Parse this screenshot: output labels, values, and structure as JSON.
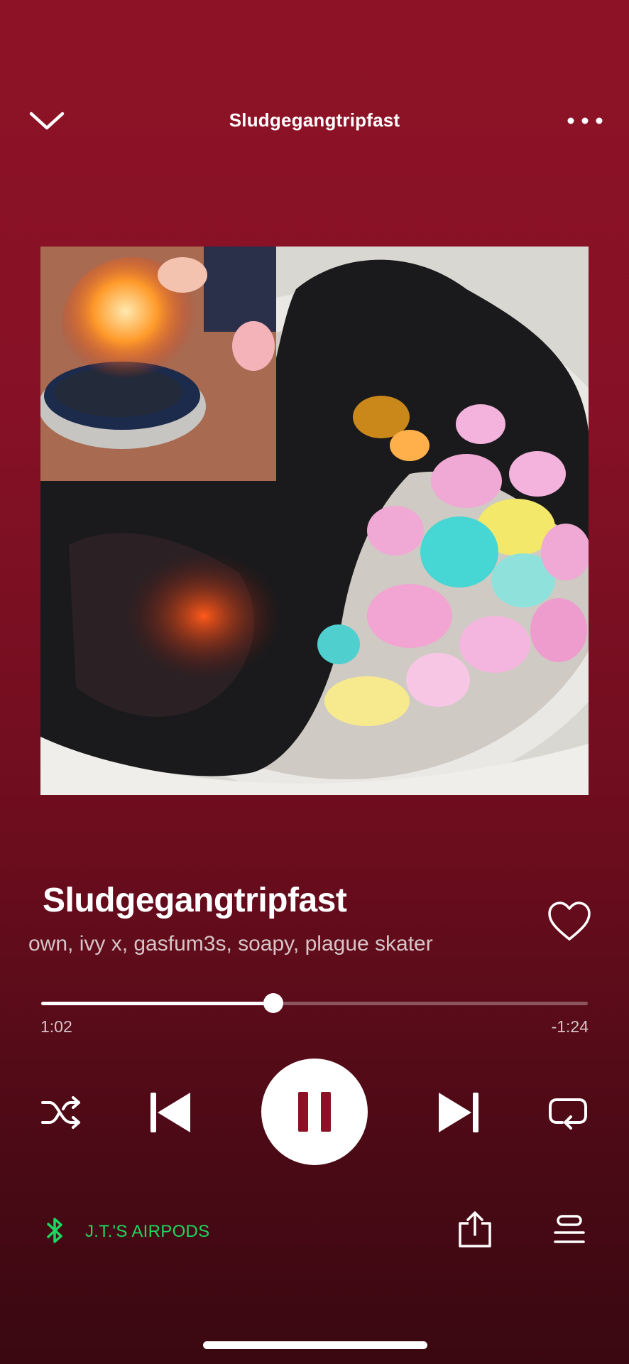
{
  "header": {
    "title": "Sludgegangtripfast",
    "collapse_icon": "chevron-down-icon",
    "more_icon": "more-horizontal-icon"
  },
  "artwork": {
    "description_icon": "album-art"
  },
  "track": {
    "title": "Sludgegangtripfast",
    "artists": "own, ivy x, gasfum3s, soapy, plague skater",
    "liked": false
  },
  "progress": {
    "fraction": 0.425,
    "elapsed": "1:02",
    "remaining": "-1:24"
  },
  "controls": {
    "shuffle_icon": "shuffle-icon",
    "previous_icon": "skip-previous-icon",
    "play_state": "playing",
    "pause_icon": "pause-icon",
    "next_icon": "skip-next-icon",
    "repeat_icon": "repeat-icon"
  },
  "device": {
    "icon": "bluetooth-icon",
    "name": "J.T.'S AIRPODS"
  },
  "actions": {
    "share_icon": "share-icon",
    "queue_icon": "queue-icon"
  },
  "colors": {
    "background": "#861126",
    "accent_green": "#1ed760",
    "text_secondary": "#d6c4c7"
  }
}
